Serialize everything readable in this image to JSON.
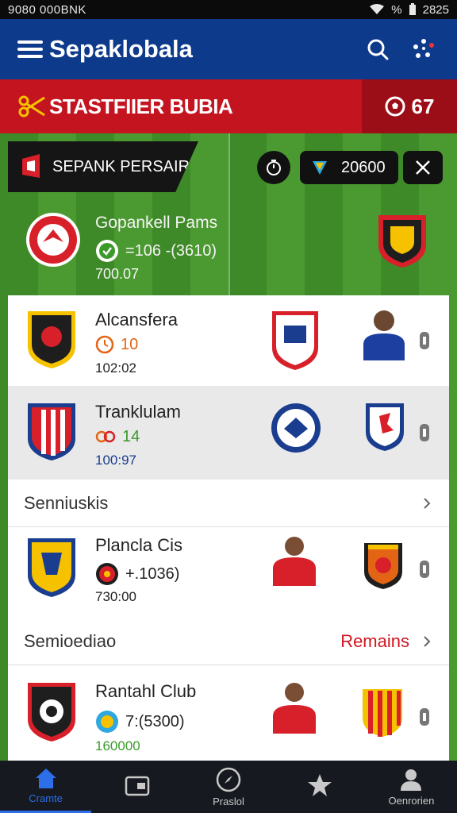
{
  "status_bar": {
    "left": "9080 000BNK",
    "battery": "%",
    "right": "2825"
  },
  "app_bar": {
    "title": "Sepaklobala",
    "icons": [
      "menu-icon",
      "search-icon",
      "dots-icon"
    ]
  },
  "promo": {
    "text": "STASTFIIER BUBIA",
    "count": "67"
  },
  "featured": {
    "tag": "SEPANK PERSAIR",
    "pill_value": "20600",
    "match": {
      "name": "Gopankell Pams",
      "score": "=106 -(3610)",
      "time": "700.07"
    }
  },
  "matches": [
    {
      "name": "Alcansfera",
      "score": "10",
      "time": "102:02",
      "score_color": "#e36414"
    },
    {
      "name": "Tranklulam",
      "score": "14",
      "time": "100:97",
      "score_color": "#3a9a2a"
    }
  ],
  "section_1": {
    "label": "Senniuskis"
  },
  "match_3": {
    "name": "Plancla Cis",
    "score": "+.1036)",
    "time": "730:00"
  },
  "section_2": {
    "label": "Semioediao",
    "link": "Remains"
  },
  "match_4": {
    "name": "Rantahl Club",
    "score": "7:(5300)",
    "time": "160000"
  },
  "bottom_nav": [
    {
      "label": "Cramte",
      "icon": "home-icon"
    },
    {
      "label": "",
      "icon": "wallet-icon"
    },
    {
      "label": "Praslol",
      "icon": "compass-icon"
    },
    {
      "label": "",
      "icon": "star-icon"
    },
    {
      "label": "Oenrorien",
      "icon": "profile-icon"
    }
  ],
  "colors": {
    "primary": "#0e3a8c",
    "accent": "#c41420",
    "active_nav": "#2c6fe8"
  }
}
